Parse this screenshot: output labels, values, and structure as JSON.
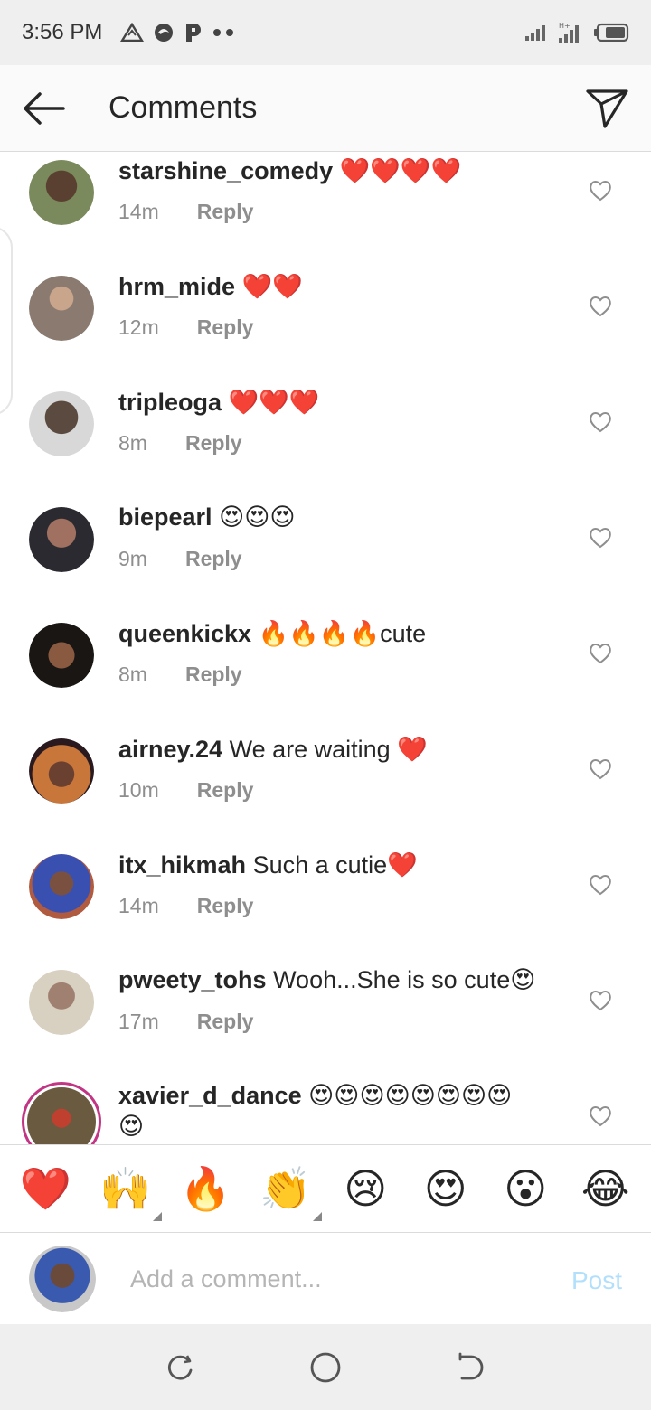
{
  "status_bar": {
    "time": "3:56 PM",
    "left_icons": [
      "warning-triangle-icon",
      "app-swirl-icon",
      "p-app-icon",
      "more-dots-icon"
    ],
    "right_icons": [
      "signal-icon",
      "data-signal-icon",
      "battery-icon"
    ]
  },
  "header": {
    "title": "Comments",
    "back_icon": "back-arrow-icon",
    "send_icon": "direct-send-icon"
  },
  "comments": [
    {
      "username": "starshine_comedy",
      "text": "❤️❤️❤️❤️",
      "time": "14m",
      "reply": "Reply",
      "avatar_color": "#7a8a5c"
    },
    {
      "username": "hrm_mide",
      "text": "❤️❤️",
      "time": "12m",
      "reply": "Reply",
      "avatar_color": "#8a7a70"
    },
    {
      "username": "tripleoga",
      "text": "❤️❤️❤️",
      "time": "8m",
      "reply": "Reply",
      "avatar_color": "#5a4a40"
    },
    {
      "username": "biepearl",
      "text": "😍😍😍",
      "time": "9m",
      "reply": "Reply",
      "avatar_color": "#6a5060"
    },
    {
      "username": "queenkickx",
      "text": "🔥🔥🔥🔥cute",
      "time": "8m",
      "reply": "Reply",
      "avatar_color": "#3a2a28"
    },
    {
      "username": "airney.24",
      "text": "We are waiting ❤️",
      "time": "10m",
      "reply": "Reply",
      "avatar_color": "#b06a3a"
    },
    {
      "username": "itx_hikmah",
      "text": "Such a cutie❤️",
      "time": "14m",
      "reply": "Reply",
      "avatar_color": "#4a4a8a"
    },
    {
      "username": "pweety_tohs",
      "text": "Wooh...She is so cute😍",
      "time": "17m",
      "reply": "Reply",
      "avatar_color": "#8a8070"
    },
    {
      "username": "xavier_d_dance",
      "text": "😍😍😍😍😍😍😍😍",
      "text_line2": "😍",
      "time": "",
      "reply": "",
      "avatar_color": "#6a5a40"
    }
  ],
  "emoji_bar": [
    "❤️",
    "🙌",
    "🔥",
    "👏",
    "😢",
    "😍",
    "😮",
    "😂"
  ],
  "composer": {
    "placeholder": "Add a comment...",
    "post_label": "Post"
  },
  "nav_icons": [
    "recents-icon",
    "home-circle-icon",
    "back-nav-icon"
  ],
  "colors": {
    "heart_red": "#e0245e",
    "post_blue_disabled": "#b2dffc",
    "meta_gray": "#8e8e8e",
    "story_ring": "#c13584"
  }
}
